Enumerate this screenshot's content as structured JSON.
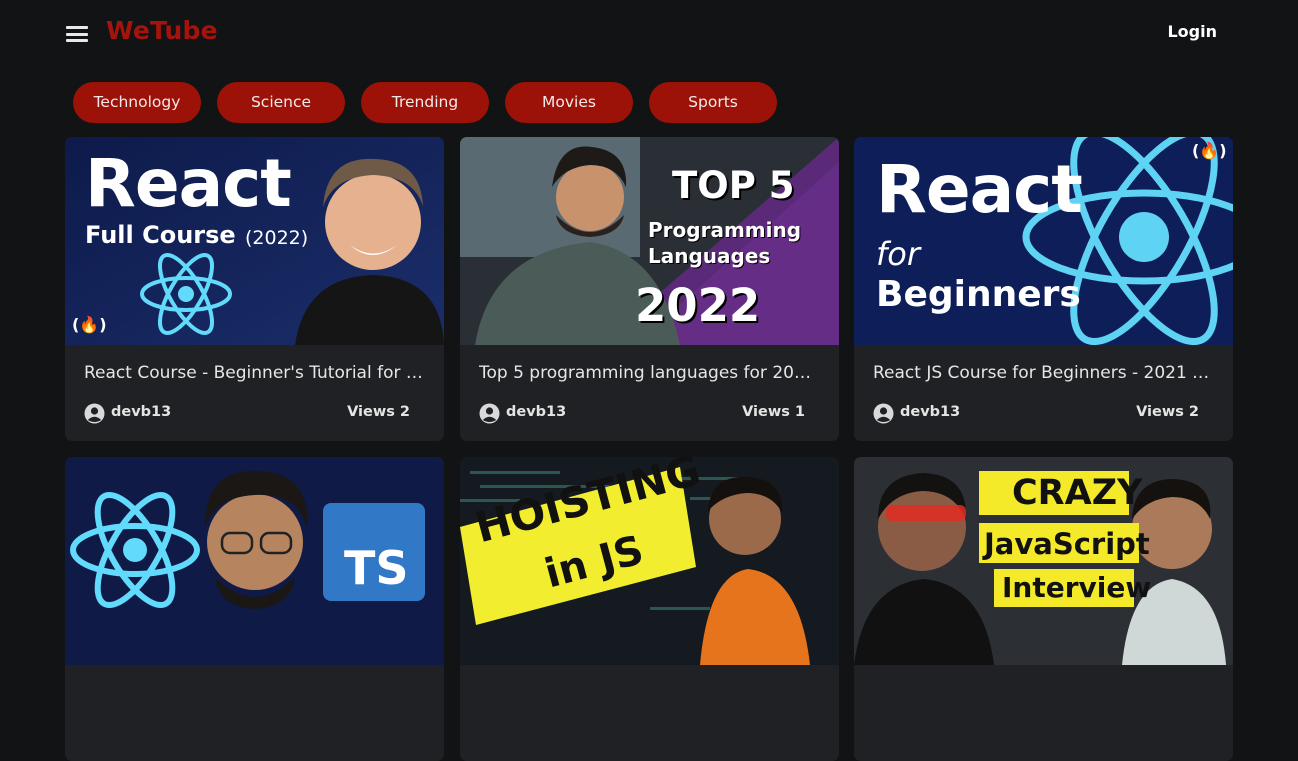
{
  "header": {
    "brand": "WeTube",
    "login_label": "Login"
  },
  "categories": [
    "Technology",
    "Science",
    "Trending",
    "Movies",
    "Sports"
  ],
  "videos": [
    {
      "title": "React Course - Beginner's Tutorial for …",
      "channel": "devb13",
      "views": "Views 2",
      "thumb": {
        "line1": "React",
        "line2": "Full Course",
        "line3": "(2022)",
        "badge": "(🔥)"
      }
    },
    {
      "title": "Top 5 programming languages for 20…",
      "channel": "devb13",
      "views": "Views 1",
      "thumb": {
        "line1": "TOP 5",
        "line2": "Programming",
        "line3": "Languages",
        "line4": "2022"
      }
    },
    {
      "title": "React JS Course for Beginners - 2021 …",
      "channel": "devb13",
      "views": "Views 2",
      "thumb": {
        "line1": "React",
        "line2": "for",
        "line3": "Beginners",
        "badge": "(🔥)"
      }
    },
    {
      "title": "",
      "channel": "",
      "views": "",
      "thumb": {
        "badge": "TS"
      }
    },
    {
      "title": "",
      "channel": "",
      "views": "",
      "thumb": {
        "line1": "HOISTING",
        "line2": "in JS"
      }
    },
    {
      "title": "",
      "channel": "",
      "views": "",
      "thumb": {
        "line1": "CRAZY",
        "line2": "JavaScript",
        "line3": "Interview"
      }
    }
  ],
  "colors": {
    "background": "#121315",
    "brand": "#a5140c",
    "chip": "#9c1208",
    "card": "#202124"
  },
  "icons": {
    "menu": "hamburger-icon",
    "avatar": "user-circle-icon"
  }
}
